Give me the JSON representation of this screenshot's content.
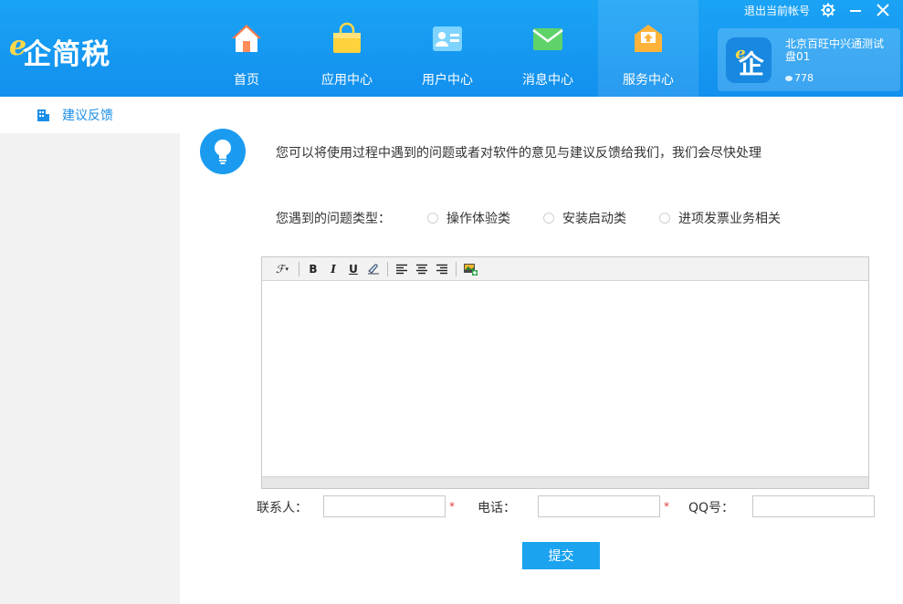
{
  "app": {
    "logo_mark": "e",
    "logo_text": "企简税"
  },
  "nav": {
    "items": [
      {
        "label": "首页",
        "icon": "home-icon"
      },
      {
        "label": "应用中心",
        "icon": "shopping-bag-icon"
      },
      {
        "label": "用户中心",
        "icon": "user-card-icon"
      },
      {
        "label": "消息中心",
        "icon": "envelope-icon"
      },
      {
        "label": "服务中心",
        "icon": "service-box-icon",
        "active": true
      }
    ]
  },
  "topbar": {
    "logout_label": "退出当前帐号",
    "icons": [
      "gear-icon",
      "minimize-icon",
      "close-icon"
    ]
  },
  "user": {
    "avatar_mark": "e",
    "avatar_text": "企",
    "name": "北京百旺中兴通测试盘01",
    "coins": "778"
  },
  "sidebar": {
    "items": [
      {
        "label": "建议反馈",
        "icon": "building-icon",
        "active": true
      }
    ]
  },
  "feedback": {
    "intro": "您可以将使用过程中遇到的问题或者对软件的意见与建议反馈给我们，我们会尽快处理",
    "question_type_label": "您遇到的问题类型：",
    "options": [
      "操作体验类",
      "安装启动类",
      "进项发票业务相关"
    ],
    "toolbar": {
      "font": "ℱ",
      "bold": "B",
      "italic": "I",
      "underline": "U"
    },
    "contact_label": "联系人：",
    "phone_label": "电话：",
    "qq_label": "QQ号：",
    "required_mark": "*",
    "submit_label": "提交"
  },
  "colors": {
    "header": "#1290ee",
    "accent": "#1ba3f0",
    "sidebar_bg": "#f2f2f2",
    "required": "#e23b3b"
  }
}
